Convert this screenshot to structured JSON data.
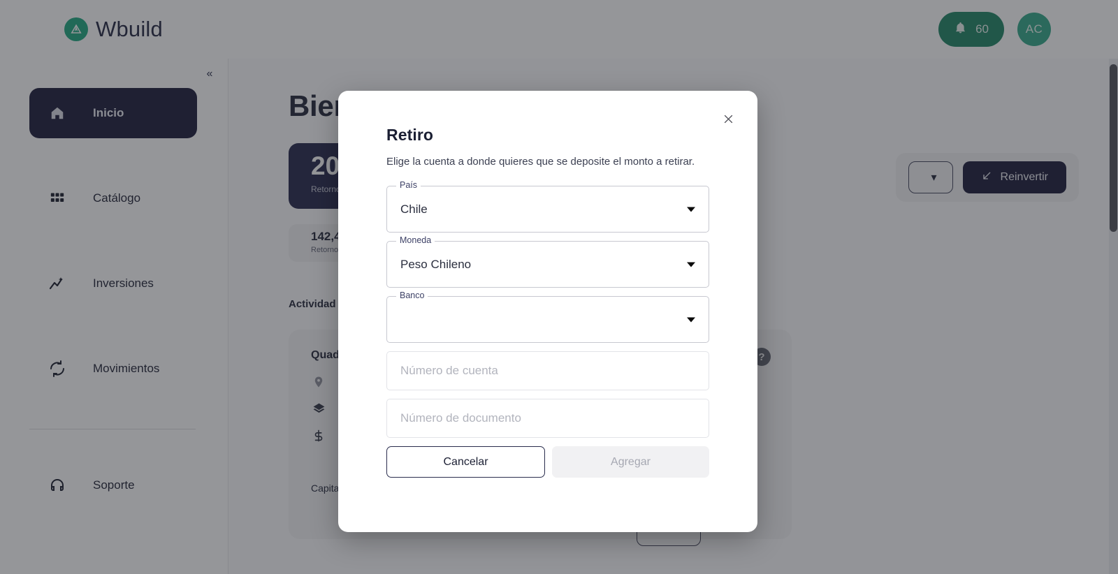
{
  "header": {
    "brand_name": "Wbuild",
    "brand_icon": "wbuild-logo-icon",
    "notifications": {
      "icon": "bell-icon",
      "count": "60"
    },
    "avatar_initials": "AC"
  },
  "sidebar": {
    "collapse_icon": "chevron-double-left-icon",
    "items": [
      {
        "label": "Inicio",
        "icon": "home-icon",
        "active": true
      },
      {
        "label": "Catálogo",
        "icon": "grid-icon",
        "active": false
      },
      {
        "label": "Inversiones",
        "icon": "trending-up-icon",
        "active": false
      },
      {
        "label": "Movimientos",
        "icon": "sync-icon",
        "active": false
      }
    ],
    "support": {
      "label": "Soporte",
      "icon": "headset-icon"
    }
  },
  "main": {
    "welcome_title": "Bienvenido",
    "stat_primary": {
      "value": "20",
      "caption": "Retorno"
    },
    "stat_secondary": {
      "value": "142,4",
      "caption": "Retorno"
    },
    "actions": {
      "ghost_label": "",
      "reinvest_label": "Reinvertir",
      "reinvest_icon": "arrow-down-left-icon"
    },
    "section_title": "Actividad R",
    "activity": {
      "name": "Quad",
      "help_icon": "question-mark-icon",
      "rows": [
        {
          "icon": "location-pin-icon",
          "text": ""
        },
        {
          "icon": "layers-icon",
          "text": ""
        },
        {
          "icon": "dollar-icon",
          "text": ""
        }
      ]
    },
    "capital_text": "Capital"
  },
  "modal": {
    "title": "Retiro",
    "subtitle": "Elige la cuenta a donde quieres que se deposite el monto a retirar.",
    "close_icon": "close-icon",
    "selects": [
      {
        "legend": "País",
        "value": "Chile",
        "caret_icon": "caret-down-icon"
      },
      {
        "legend": "Moneda",
        "value": "Peso Chileno",
        "caret_icon": "caret-down-icon"
      },
      {
        "legend": "Banco",
        "value": "",
        "caret_icon": "caret-down-icon"
      }
    ],
    "inputs": [
      {
        "placeholder": "Número de cuenta",
        "value": ""
      },
      {
        "placeholder": "Número de documento",
        "value": ""
      }
    ],
    "cancel_label": "Cancelar",
    "submit_label": "Agregar"
  },
  "colors": {
    "brand_green": "#16a47b",
    "notif_green": "#16805f",
    "avatar_green": "#2aa585",
    "dark_navy": "#121232",
    "scrim": "rgba(44,46,52,0.5)"
  }
}
